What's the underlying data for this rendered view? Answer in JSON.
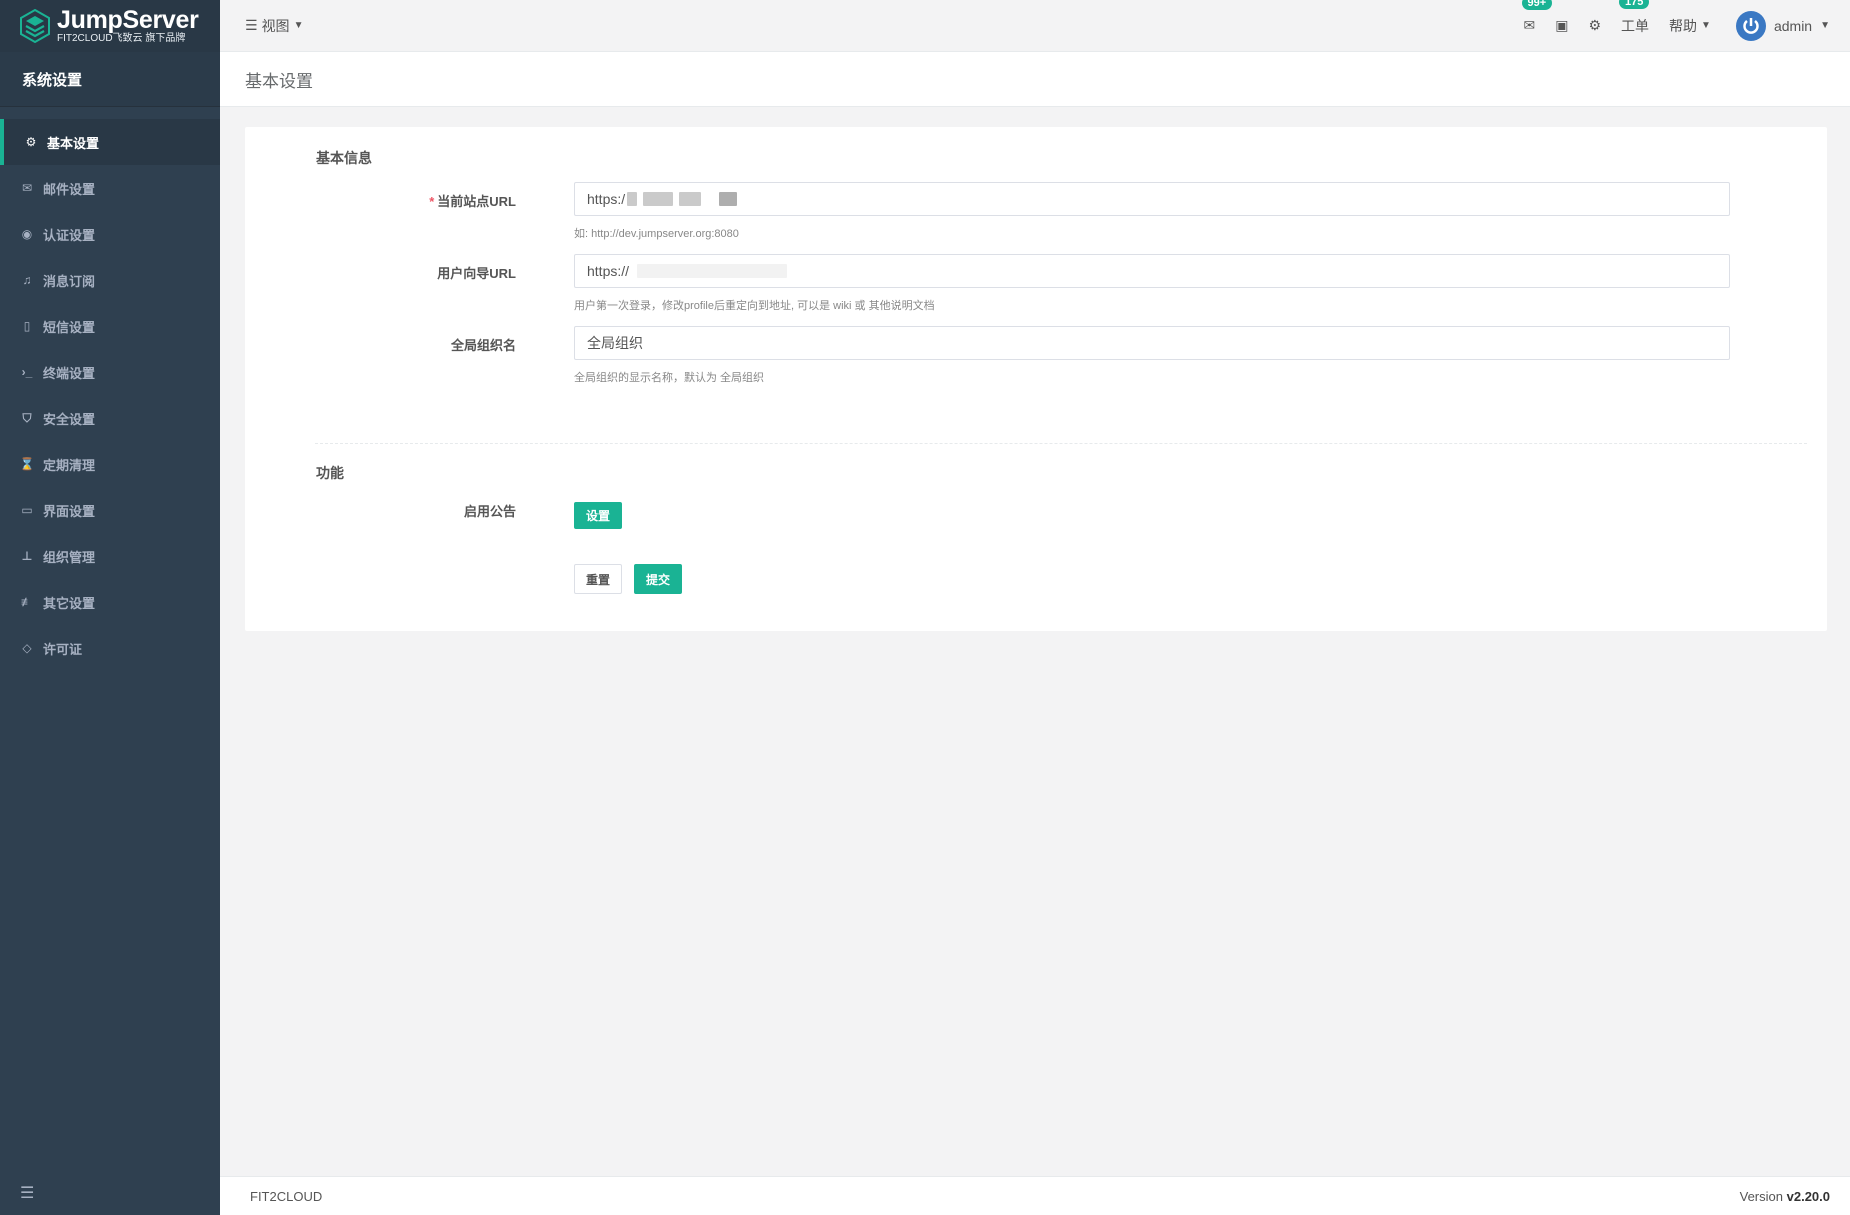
{
  "brand": {
    "title": "JumpServer",
    "subtitle": "FIT2CLOUD飞致云 旗下品牌"
  },
  "sidebar": {
    "section_title": "系统设置",
    "items": [
      {
        "label": "基本设置",
        "icon": "gear-icon",
        "active": true
      },
      {
        "label": "邮件设置",
        "icon": "envelope-icon"
      },
      {
        "label": "认证设置",
        "icon": "user-circle-icon"
      },
      {
        "label": "消息订阅",
        "icon": "bell-icon"
      },
      {
        "label": "短信设置",
        "icon": "mobile-icon"
      },
      {
        "label": "终端设置",
        "icon": "terminal-icon"
      },
      {
        "label": "安全设置",
        "icon": "shield-icon"
      },
      {
        "label": "定期清理",
        "icon": "hourglass-icon"
      },
      {
        "label": "界面设置",
        "icon": "laptop-icon"
      },
      {
        "label": "组织管理",
        "icon": "sitemap-icon"
      },
      {
        "label": "其它设置",
        "icon": "sliders-icon"
      },
      {
        "label": "许可证",
        "icon": "diamond-icon"
      }
    ]
  },
  "topbar": {
    "view_label": "视图",
    "mail_badge": "99+",
    "tickets_label": "工单",
    "tickets_badge": "175",
    "help_label": "帮助",
    "user_name": "admin"
  },
  "page": {
    "title": "基本设置"
  },
  "form": {
    "basic_section": "基本信息",
    "site_url_label": "当前站点URL",
    "site_url_value": "https:/",
    "site_url_hint": "如: http://dev.jumpserver.org:8080",
    "guide_url_label": "用户向导URL",
    "guide_url_value": "https://",
    "guide_url_hint": "用户第一次登录，修改profile后重定向到地址, 可以是 wiki 或 其他说明文档",
    "org_name_label": "全局组织名",
    "org_name_value": "全局组织",
    "org_name_hint": "全局组织的显示名称，默认为 全局组织",
    "feature_section": "功能",
    "announcement_label": "启用公告",
    "announcement_button": "设置",
    "reset_button": "重置",
    "submit_button": "提交"
  },
  "footer": {
    "company": "FIT2CLOUD",
    "version_prefix": "Version",
    "version": "v2.20.0"
  },
  "colors": {
    "sidebar": "#2f4050",
    "accent": "#1ab394",
    "badge": "#1ab394"
  }
}
